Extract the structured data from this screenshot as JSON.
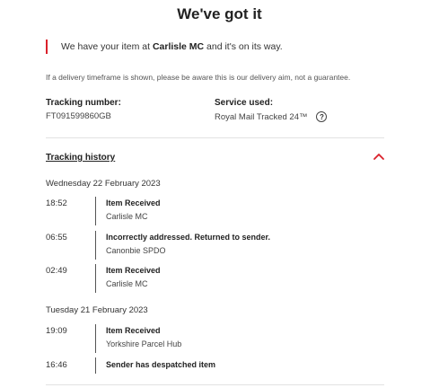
{
  "page": {
    "title": "We've got it",
    "notice_prefix": "We have your item at ",
    "notice_location": "Carlisle MC",
    "notice_suffix": " and it's on its way.",
    "disclaimer": "If a delivery timeframe is shown, please be aware this is our delivery aim, not a guarantee.",
    "accent_color": "#da202a"
  },
  "details": {
    "tracking_label": "Tracking number:",
    "tracking_value": "FT091599860GB",
    "service_label": "Service used:",
    "service_value": "Royal Mail Tracked 24™",
    "help_glyph": "?"
  },
  "history": {
    "title": "Tracking history",
    "toggle_icon": "chevron-up-icon",
    "days": [
      {
        "date": "Wednesday 22 February 2023",
        "events": [
          {
            "time": "18:52",
            "status": "Item Received",
            "location": "Carlisle MC"
          },
          {
            "time": "06:55",
            "status": "Incorrectly addressed. Returned to sender.",
            "location": "Canonbie SPDO"
          },
          {
            "time": "02:49",
            "status": "Item Received",
            "location": "Carlisle MC"
          }
        ]
      },
      {
        "date": "Tuesday 21 February 2023",
        "events": [
          {
            "time": "19:09",
            "status": "Item Received",
            "location": "Yorkshire Parcel Hub"
          },
          {
            "time": "16:46",
            "status": "Sender has despatched item",
            "location": ""
          }
        ]
      }
    ]
  }
}
